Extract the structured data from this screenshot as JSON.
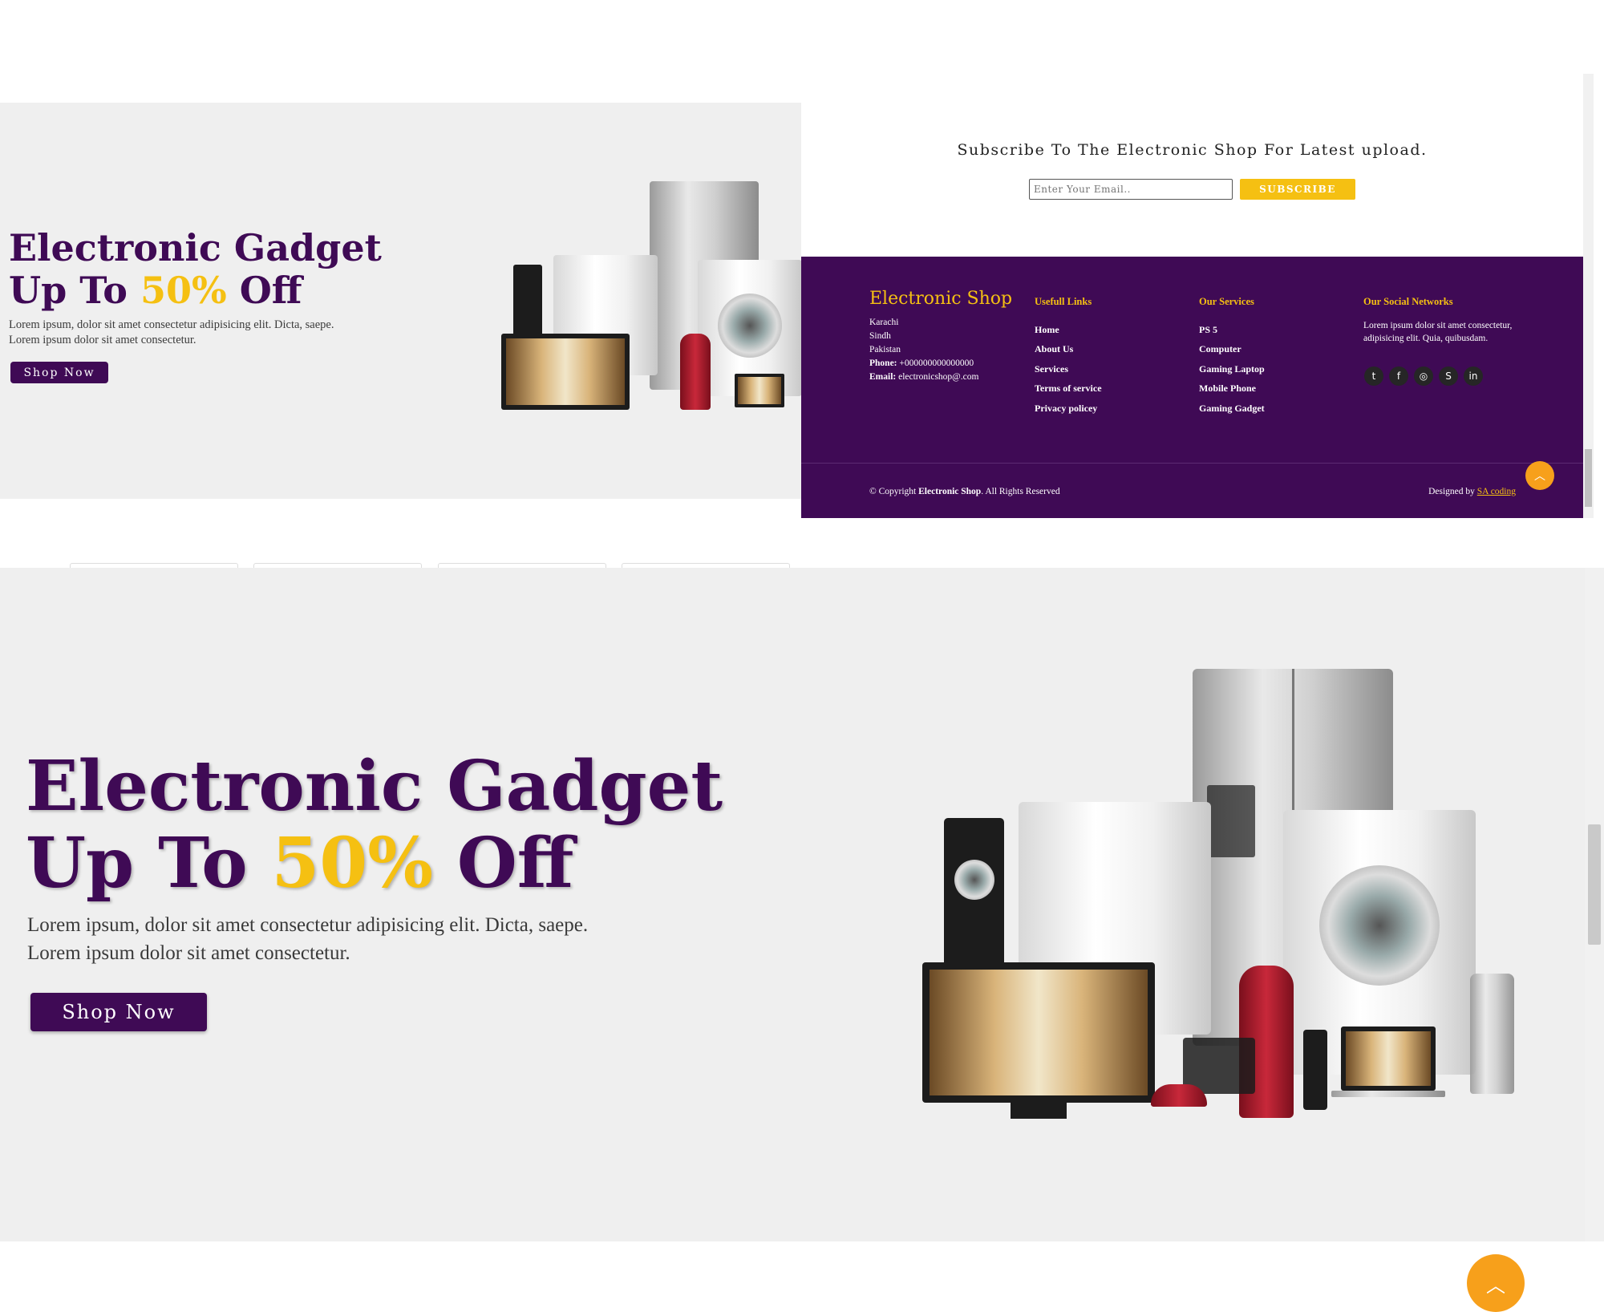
{
  "hero": {
    "title_line1": "Electronic Gadget",
    "title_line2_prefix": "Up To ",
    "title_line2_accent": "50%",
    "title_line2_suffix": " Off",
    "desc_line1": "Lorem ipsum, dolor sit amet consectetur adipisicing elit. Dicta, saepe.",
    "desc_line2": "Lorem ipsum dolor sit amet consectetur.",
    "button": "Shop Now"
  },
  "subscribe": {
    "title": "Subscribe To The Electronic Shop For Latest upload.",
    "placeholder": "Enter Your Email..",
    "button": "SUBSCRIBE"
  },
  "footer": {
    "brand": "Electronic Shop",
    "address": [
      "Karachi",
      "Sindh",
      "Pakistan"
    ],
    "phone_label": "Phone:",
    "phone": "+000000000000000",
    "email_label": "Email:",
    "email": "electronicshop@.com",
    "useful_links_heading": "Usefull Links",
    "useful_links": [
      "Home",
      "About Us",
      "Services",
      "Terms of service",
      "Privacy policey"
    ],
    "services_heading": "Our Services",
    "services": [
      "PS 5",
      "Computer",
      "Gaming Laptop",
      "Mobile Phone",
      "Gaming Gadget"
    ],
    "social_heading": "Our Social Networks",
    "social_text": "Lorem ipsum dolor sit amet consectetur, adipisicing elit. Quia, quibusdam.",
    "social_icons": [
      "twitter-icon",
      "facebook-icon",
      "instagram-icon",
      "skype-icon",
      "linkedin-icon"
    ],
    "copyright_prefix": "© Copyright ",
    "copyright_brand": "Electronic Shop",
    "copyright_suffix": ". All Rights Reserved",
    "designed_by_prefix": "Designed by ",
    "designed_by_link": "SA coding"
  },
  "colors": {
    "brand_purple": "#3f0a55",
    "accent_yellow": "#f5c012",
    "back_to_top_orange": "#f7a01b",
    "hero_bg": "#efefef"
  }
}
